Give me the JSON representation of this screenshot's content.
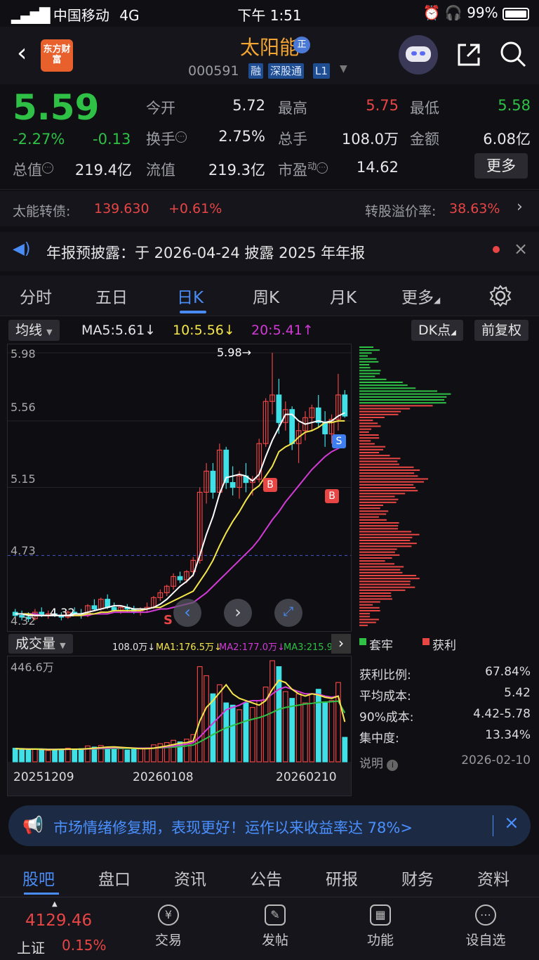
{
  "status_bar": {
    "carrier": "中国移动",
    "network": "4G",
    "time": "下午 1:51",
    "battery": "99%"
  },
  "header": {
    "logo_text": "东方财富",
    "stock_name": "太阳能",
    "badge": "正",
    "stock_code": "000591",
    "tags": [
      "融",
      "深股通",
      "L1"
    ]
  },
  "quote": {
    "price": "5.59",
    "change_pct": "-2.27%",
    "change": "-0.13",
    "fields": [
      {
        "label": "今开",
        "value": "5.72",
        "color": "#e8e8e8"
      },
      {
        "label": "最高",
        "value": "5.75",
        "color": "#e84545"
      },
      {
        "label": "最低",
        "value": "5.58",
        "color": "#2fc145"
      },
      {
        "label": "换手",
        "value": "2.75%",
        "color": "#e8e8e8"
      },
      {
        "label": "总手",
        "value": "108.0万",
        "color": "#e8e8e8"
      },
      {
        "label": "金额",
        "value": "6.08亿",
        "color": "#e8e8e8"
      },
      {
        "label": "总值",
        "value": "219.4亿",
        "color": "#e8e8e8"
      },
      {
        "label": "流值",
        "value": "219.3亿",
        "color": "#e8e8e8"
      },
      {
        "label": "市盈",
        "value": "14.62",
        "color": "#e8e8e8"
      }
    ],
    "pe_superscript": "动",
    "more_label": "更多"
  },
  "bond": {
    "label": "太能转债:",
    "price": "139.630",
    "change": "+0.61%",
    "premium_label": "转股溢价率:",
    "premium": "38.63%"
  },
  "notice": {
    "text": "年报预披露：于 2026-04-24 披露 2025 年年报"
  },
  "tabs": [
    "分时",
    "五日",
    "日K",
    "周K",
    "月K",
    "更多"
  ],
  "active_tab": "日K",
  "chart_toolbar": {
    "ma_select": "均线",
    "ma5": "MA5:5.61↓",
    "ma10": "10:5.56↓",
    "ma20": "20:5.41↑",
    "dk_label": "DK点",
    "adjust_label": "前复权"
  },
  "chart_labels": {
    "y_ticks": [
      "5.98",
      "5.56",
      "5.15",
      "4.73",
      "4.32"
    ],
    "high_marker": "5.98→",
    "low_marker": "4.32",
    "buy": "B",
    "sell": "S"
  },
  "volume_toolbar": {
    "select": "成交量",
    "vol": "108.0万↓",
    "ma1": "MA1:176.5万↓",
    "ma2": "MA2:177.0万↓",
    "ma3": "MA3:215.9万"
  },
  "volume_labels": {
    "max": "446.6万",
    "dates": [
      "20251209",
      "20260108",
      "20260210"
    ]
  },
  "chip": {
    "legend_trapped": "套牢",
    "legend_profit": "获利",
    "rows": [
      {
        "label": "获利比例:",
        "value": "67.84%"
      },
      {
        "label": "平均成本:",
        "value": "5.42"
      },
      {
        "label": "90%成本:",
        "value": "4.42-5.78"
      },
      {
        "label": "集中度:",
        "value": "13.34%"
      }
    ],
    "note_label": "说明",
    "date": "2026-02-10"
  },
  "banner": {
    "text": "市场情绪修复期，表现更好！运作以来收益率达 78%>"
  },
  "bottom_tabs": [
    "股吧",
    "盘口",
    "资讯",
    "公告",
    "研报",
    "财务",
    "资料"
  ],
  "index": {
    "value": "4129.46",
    "name": "上证",
    "change": "0.15%"
  },
  "bottom_nav": [
    {
      "label": "交易",
      "icon": "¥"
    },
    {
      "label": "发帖",
      "icon": "✎"
    },
    {
      "label": "功能",
      "icon": "▦"
    },
    {
      "label": "设自选",
      "icon": "⋯"
    }
  ],
  "colors": {
    "up": "#e84545",
    "down": "#2fc145",
    "accent": "#4a8cf5",
    "cyan": "#3fe0e6"
  },
  "chart_data": {
    "type": "candlestick",
    "ohlc": [
      [
        4.38,
        4.4,
        4.33,
        4.36
      ],
      [
        4.36,
        4.39,
        4.33,
        4.35
      ],
      [
        4.35,
        4.38,
        4.32,
        4.34
      ],
      [
        4.34,
        4.4,
        4.33,
        4.38
      ],
      [
        4.38,
        4.41,
        4.35,
        4.36
      ],
      [
        4.36,
        4.39,
        4.34,
        4.37
      ],
      [
        4.37,
        4.4,
        4.35,
        4.36
      ],
      [
        4.36,
        4.38,
        4.33,
        4.35
      ],
      [
        4.35,
        4.39,
        4.34,
        4.38
      ],
      [
        4.38,
        4.41,
        4.36,
        4.37
      ],
      [
        4.37,
        4.4,
        4.34,
        4.36
      ],
      [
        4.36,
        4.43,
        4.35,
        4.42
      ],
      [
        4.42,
        4.46,
        4.39,
        4.4
      ],
      [
        4.4,
        4.47,
        4.39,
        4.46
      ],
      [
        4.46,
        4.49,
        4.4,
        4.41
      ],
      [
        4.41,
        4.44,
        4.38,
        4.39
      ],
      [
        4.39,
        4.42,
        4.37,
        4.41
      ],
      [
        4.41,
        4.43,
        4.38,
        4.4
      ],
      [
        4.4,
        4.42,
        4.37,
        4.38
      ],
      [
        4.38,
        4.41,
        4.36,
        4.4
      ],
      [
        4.4,
        4.44,
        4.38,
        4.41
      ],
      [
        4.41,
        4.48,
        4.4,
        4.47
      ],
      [
        4.47,
        4.52,
        4.45,
        4.5
      ],
      [
        4.5,
        4.55,
        4.48,
        4.54
      ],
      [
        4.54,
        4.62,
        4.52,
        4.6
      ],
      [
        4.6,
        4.63,
        4.56,
        4.58
      ],
      [
        4.58,
        4.64,
        4.56,
        4.63
      ],
      [
        4.63,
        4.72,
        4.6,
        4.7
      ],
      [
        4.7,
        5.15,
        4.68,
        5.12
      ],
      [
        5.12,
        5.3,
        5.05,
        5.25
      ],
      [
        5.25,
        5.3,
        5.08,
        5.12
      ],
      [
        5.12,
        5.42,
        5.1,
        5.38
      ],
      [
        5.38,
        5.4,
        5.14,
        5.18
      ],
      [
        5.18,
        5.28,
        5.1,
        5.15
      ],
      [
        5.15,
        5.25,
        5.08,
        5.22
      ],
      [
        5.22,
        5.3,
        5.12,
        5.18
      ],
      [
        5.18,
        5.22,
        5.1,
        5.2
      ],
      [
        5.2,
        5.45,
        5.18,
        5.42
      ],
      [
        5.42,
        5.7,
        5.4,
        5.68
      ],
      [
        5.68,
        5.98,
        5.6,
        5.72
      ],
      [
        5.72,
        5.82,
        5.48,
        5.55
      ],
      [
        5.55,
        5.68,
        5.5,
        5.63
      ],
      [
        5.63,
        5.65,
        5.38,
        5.42
      ],
      [
        5.42,
        5.55,
        5.3,
        5.5
      ],
      [
        5.5,
        5.62,
        5.44,
        5.58
      ],
      [
        5.58,
        5.66,
        5.5,
        5.64
      ],
      [
        5.64,
        5.72,
        5.52,
        5.55
      ],
      [
        5.55,
        5.62,
        5.4,
        5.48
      ],
      [
        5.48,
        5.6,
        5.42,
        5.57
      ],
      [
        5.57,
        5.85,
        5.5,
        5.72
      ],
      [
        5.72,
        5.75,
        5.58,
        5.59
      ]
    ],
    "ma5": [
      4.37,
      4.37,
      4.36,
      4.36,
      4.36,
      4.36,
      4.36,
      4.36,
      4.36,
      4.37,
      4.37,
      4.38,
      4.39,
      4.4,
      4.41,
      4.42,
      4.42,
      4.41,
      4.4,
      4.4,
      4.4,
      4.41,
      4.43,
      4.46,
      4.5,
      4.54,
      4.57,
      4.61,
      4.73,
      4.86,
      4.97,
      5.11,
      5.21,
      5.22,
      5.23,
      5.22,
      5.19,
      5.23,
      5.34,
      5.44,
      5.52,
      5.6,
      5.6,
      5.56,
      5.54,
      5.55,
      5.56,
      5.55,
      5.56,
      5.59,
      5.61
    ],
    "ma10": [
      4.37,
      4.37,
      4.37,
      4.36,
      4.36,
      4.36,
      4.36,
      4.36,
      4.36,
      4.36,
      4.36,
      4.37,
      4.37,
      4.38,
      4.38,
      4.39,
      4.39,
      4.39,
      4.39,
      4.39,
      4.4,
      4.41,
      4.41,
      4.43,
      4.45,
      4.47,
      4.49,
      4.51,
      4.57,
      4.63,
      4.7,
      4.79,
      4.87,
      4.94,
      5.0,
      5.07,
      5.13,
      5.16,
      5.22,
      5.28,
      5.37,
      5.4,
      5.42,
      5.46,
      5.49,
      5.5,
      5.52,
      5.55,
      5.55,
      5.56,
      5.56
    ],
    "ma20": [
      4.37,
      4.37,
      4.37,
      4.37,
      4.36,
      4.36,
      4.36,
      4.36,
      4.36,
      4.36,
      4.36,
      4.36,
      4.37,
      4.37,
      4.37,
      4.38,
      4.38,
      4.38,
      4.38,
      4.38,
      4.38,
      4.39,
      4.4,
      4.4,
      4.41,
      4.42,
      4.43,
      4.44,
      4.47,
      4.5,
      4.54,
      4.58,
      4.62,
      4.66,
      4.7,
      4.74,
      4.78,
      4.83,
      4.89,
      4.95,
      5.0,
      5.06,
      5.11,
      5.16,
      5.21,
      5.26,
      5.3,
      5.34,
      5.37,
      5.39,
      5.41
    ],
    "volume_wan": [
      60,
      55,
      52,
      58,
      55,
      50,
      53,
      55,
      60,
      52,
      58,
      70,
      65,
      72,
      60,
      55,
      58,
      52,
      55,
      60,
      62,
      75,
      80,
      85,
      95,
      88,
      100,
      120,
      420,
      380,
      300,
      340,
      260,
      250,
      230,
      260,
      240,
      270,
      330,
      446,
      420,
      310,
      280,
      300,
      260,
      300,
      320,
      260,
      270,
      350,
      108
    ],
    "vol_ma1": [
      58,
      57,
      56,
      56,
      55,
      54,
      54,
      55,
      56,
      56,
      56,
      58,
      60,
      63,
      65,
      66,
      64,
      62,
      60,
      58,
      58,
      60,
      65,
      70,
      76,
      82,
      85,
      92,
      180,
      240,
      270,
      305,
      340,
      300,
      280,
      270,
      260,
      250,
      270,
      320,
      360,
      350,
      320,
      300,
      290,
      300,
      295,
      285,
      280,
      290,
      176.5
    ],
    "vol_ma2": [
      58,
      57,
      57,
      56,
      56,
      55,
      55,
      55,
      55,
      56,
      56,
      57,
      58,
      60,
      61,
      62,
      62,
      62,
      61,
      60,
      60,
      61,
      63,
      66,
      70,
      74,
      78,
      84,
      110,
      140,
      170,
      200,
      230,
      240,
      250,
      265,
      270,
      270,
      275,
      300,
      320,
      330,
      320,
      310,
      300,
      300,
      298,
      290,
      285,
      290,
      177
    ],
    "vol_ma3": [
      58,
      58,
      57,
      57,
      57,
      56,
      56,
      56,
      56,
      56,
      56,
      57,
      57,
      58,
      59,
      59,
      59,
      60,
      60,
      60,
      60,
      61,
      62,
      63,
      65,
      67,
      70,
      74,
      88,
      104,
      120,
      136,
      150,
      160,
      170,
      180,
      188,
      195,
      205,
      218,
      232,
      240,
      245,
      250,
      255,
      258,
      262,
      264,
      265,
      268,
      215.9
    ],
    "y_range": [
      4.32,
      5.98
    ],
    "volume_max": 446.6
  }
}
